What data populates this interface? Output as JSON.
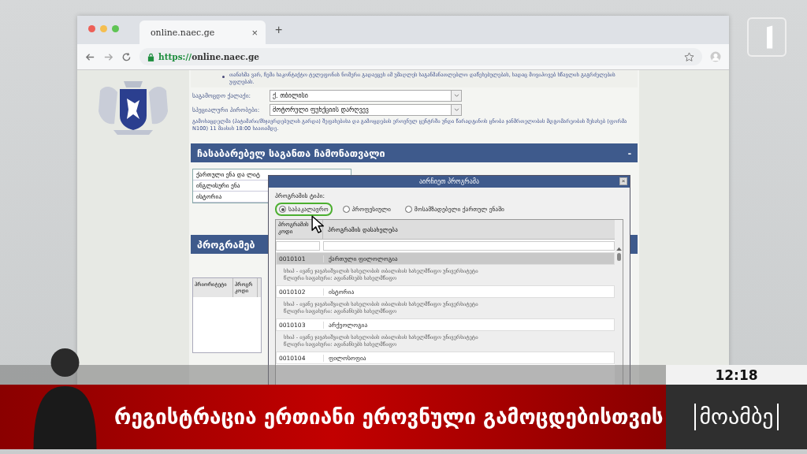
{
  "browser": {
    "tab_title": "online.naec.ge",
    "tab_close": "×",
    "new_tab": "+",
    "url_scheme": "https://",
    "url_host": "online.naec.ge"
  },
  "form": {
    "consent_text": "თანახმა ვარ, ჩემი საკონტაქტო ტელეფონის ნომერი გადაეცეს იმ უმაღლეს საგანმანათლებლო დაწესებულებას, სადაც მოვიპოვებ სწავლის გაგრძელების უფლებას.",
    "fields": [
      {
        "label": "საგამოცდო ქალაქი:",
        "value": "ქ. თბილისი"
      },
      {
        "label": "სპეციალური პირობები:",
        "value": "მოტორული ფუნქციის დარღვევ"
      }
    ],
    "note": "გამოსაცდელმა (პატიმარი/მსჯავრდებულის გარდა) შეფასებისა და გამოცდების ეროვნულ ცენტრში უნდა წარადგინოს ცნობა ჯანმრთელობის მდგომარეობის შესახებ (ფორმა N100) 11 მაისის 18:00 საათამდე."
  },
  "subjects_section": {
    "title": "ჩასაბარებელ საგანთა ჩამონათვალი",
    "collapse": "-",
    "subjects": [
      "ქართული ენა და ლიტ",
      "ინგლისური ენა",
      "ისტორია"
    ]
  },
  "programs_section": {
    "title": "პროგრამებ",
    "columns": [
      "პრიორიტეტი",
      "პროგრ კოდი"
    ]
  },
  "dialog": {
    "title": "აირჩიეთ პროგრამა",
    "close": "×",
    "type_label": "პროგრამის ტიპი:",
    "types": [
      {
        "label": "საბაკალავრო",
        "selected": true
      },
      {
        "label": "პროფესიული",
        "selected": false
      },
      {
        "label": "მოსამზადებელი ქართულ ენაში",
        "selected": false
      }
    ],
    "columns": [
      "პროგრამის კოდი",
      "პროგრამის დასახელება"
    ],
    "rows": [
      {
        "code": "0010101",
        "name": "ქართული ფილოლოგია",
        "selected": true,
        "details": [
          "სსიპ - ივანე ჯავახიშვილის სახელობის თბილისის სახელმწიფო უნივერსიტეტი",
          "წლიური საფასური: აფინანსებს სახელმწიფო"
        ]
      },
      {
        "code": "0010102",
        "name": "ისტორია",
        "selected": false,
        "details": [
          "სსიპ - ივანე ჯავახიშვილის სახელობის თბილისის სახელმწიფო უნივერსიტეტი",
          "წლიური საფასური: აფინანსებს სახელმწიფო"
        ]
      },
      {
        "code": "0010103",
        "name": "არქეოლოგია",
        "selected": false,
        "details": [
          "სსიპ - ივანე ჯავახიშვილის სახელობის თბილისის სახელმწიფო უნივერსიტეტი",
          "წლიური საფასური: აფინანსებს სახელმწიფო"
        ]
      },
      {
        "code": "0010104",
        "name": "ფილოსოფია",
        "selected": false,
        "details": []
      }
    ]
  },
  "broadcast": {
    "clock": "12:18",
    "headline": "რეგისტრაცია ერთიანი ეროვნული გამოცდებისთვის",
    "program_logo": "მოამბე"
  }
}
